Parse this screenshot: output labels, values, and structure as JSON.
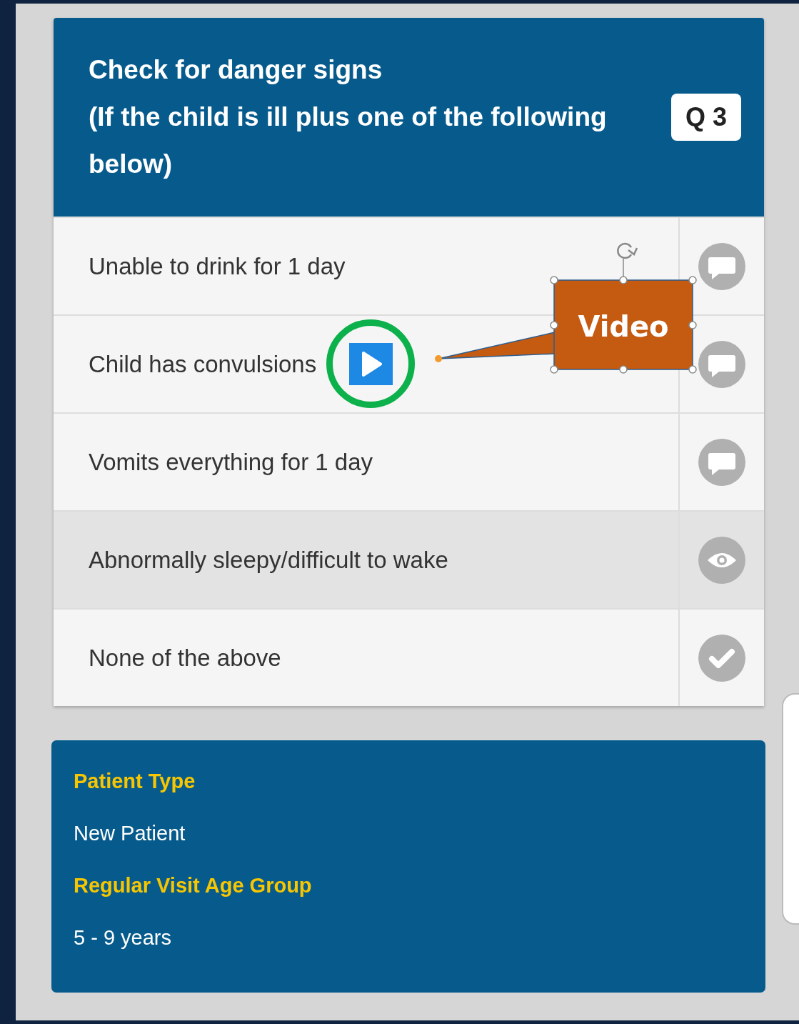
{
  "question": {
    "title_lines": [
      "Check for danger signs",
      "(If the child is ill plus one of the following below)"
    ],
    "badge": "Q 3"
  },
  "options": [
    {
      "label": "Unable to drink for 1 day",
      "kind": "comment",
      "selected": false
    },
    {
      "label": "Child has convulsions",
      "kind": "comment",
      "selected": false
    },
    {
      "label": "Vomits everything for 1 day",
      "kind": "comment",
      "selected": false
    },
    {
      "label": "Abnormally sleepy/difficult to wake",
      "kind": "eye",
      "selected": true
    },
    {
      "label": "None of the above",
      "kind": "check",
      "selected": false
    }
  ],
  "annotation": {
    "label": "Video"
  },
  "info": [
    {
      "kind": "label",
      "text": "Patient Type"
    },
    {
      "kind": "value",
      "text": "New Patient"
    },
    {
      "kind": "label",
      "text": "Regular Visit Age Group"
    },
    {
      "kind": "value",
      "text": "5 - 9 years"
    }
  ]
}
